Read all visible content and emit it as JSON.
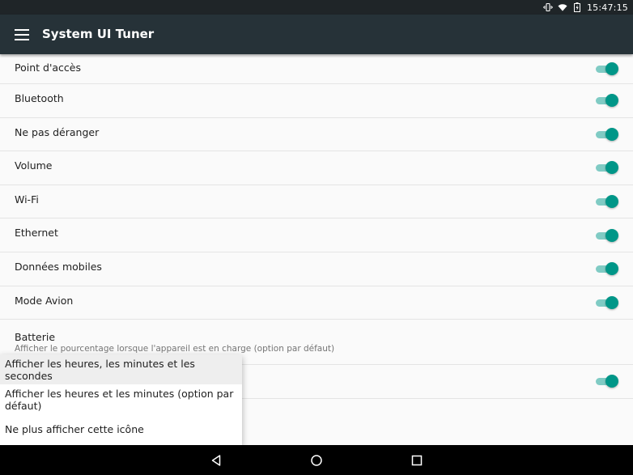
{
  "status_bar": {
    "time": "15:47:15",
    "icons": [
      "vibrate-icon",
      "wifi-icon",
      "battery-icon"
    ]
  },
  "app_bar": {
    "title": "System UI Tuner",
    "nav_icon": "menu-icon"
  },
  "settings": [
    {
      "label": "Point d'accès",
      "toggle": true
    },
    {
      "label": "Bluetooth",
      "toggle": true
    },
    {
      "label": "Ne pas déranger",
      "toggle": true
    },
    {
      "label": "Volume",
      "toggle": true
    },
    {
      "label": "Wi-Fi",
      "toggle": true
    },
    {
      "label": "Ethernet",
      "toggle": true
    },
    {
      "label": "Données mobiles",
      "toggle": true
    },
    {
      "label": "Mode Avion",
      "toggle": true
    },
    {
      "label": "Batterie",
      "summary": "Afficher le pourcentage lorsque l'appareil est en charge (option par défaut)"
    }
  ],
  "clock_row": {
    "toggle": true
  },
  "clock_menu": {
    "options": [
      "Afficher les heures, les minutes et les secondes",
      "Afficher les heures et les minutes (option par défaut)",
      "Ne plus afficher cette icône"
    ],
    "selected_index": 0
  },
  "nav_bar": {
    "buttons": [
      "back-icon",
      "home-icon",
      "recents-icon"
    ]
  },
  "colors": {
    "app_bar": "#263238",
    "status_bar": "#1f2528",
    "accent": "#009688",
    "track": "#80cbc4"
  }
}
